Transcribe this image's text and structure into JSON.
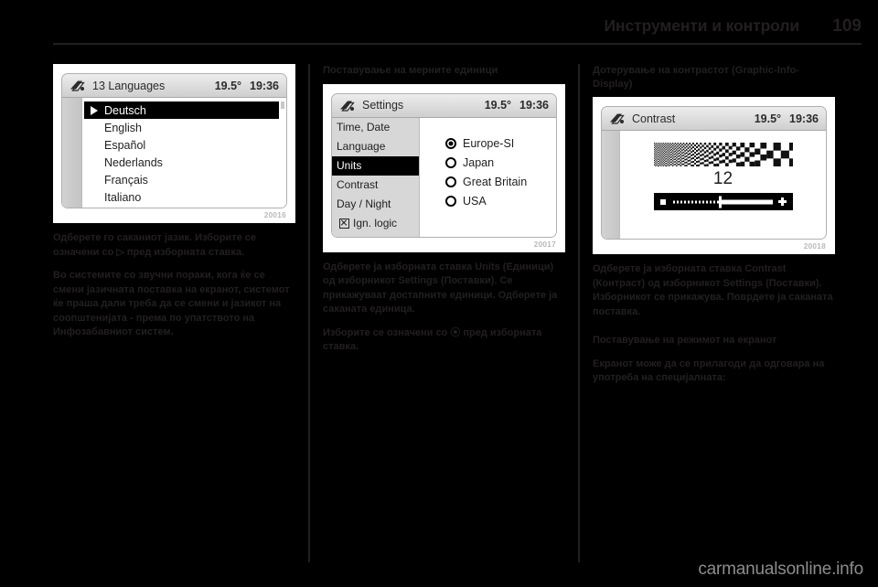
{
  "header": {
    "title": "Инструменти и контроли",
    "page_number": "109"
  },
  "watermark": "carmanualsonline.info",
  "columns": {
    "left": {
      "figure": {
        "number": "20016",
        "screen": {
          "icon": "car-info-icon",
          "title": "13 Languages",
          "temperature": "19.5°",
          "clock": "19:36",
          "items": [
            {
              "label": "Deutsch",
              "selected": true
            },
            {
              "label": "English",
              "selected": false
            },
            {
              "label": "Español",
              "selected": false
            },
            {
              "label": "Nederlands",
              "selected": false
            },
            {
              "label": "Français",
              "selected": false
            },
            {
              "label": "Italiano",
              "selected": false
            }
          ]
        }
      },
      "paragraphs": [
        "Одберете го саканиот јазик. Изборите се означени со ▷ пред изборната ставка.",
        "Во системите со звучни пораки, кога ќе се смени јазичната поставка на екранот, системот ќе праша дали треба да се смени и јазикот на соопштенијата - према по упатството на Инфозабавниот систем."
      ]
    },
    "middle": {
      "heading": "Поставување на мерните единици",
      "figure": {
        "number": "20017",
        "screen": {
          "icon": "car-info-icon",
          "title": "Settings",
          "temperature": "19.5°",
          "clock": "19:36",
          "menu": [
            {
              "label": "Time, Date",
              "selected": false,
              "checkbox": false
            },
            {
              "label": "Language",
              "selected": false,
              "checkbox": false
            },
            {
              "label": "Units",
              "selected": true,
              "checkbox": false
            },
            {
              "label": "Contrast",
              "selected": false,
              "checkbox": false
            },
            {
              "label": "Day / Night",
              "selected": false,
              "checkbox": false
            },
            {
              "label": "Ign. logic",
              "selected": false,
              "checkbox": true
            }
          ],
          "options": [
            {
              "label": "Europe-SI",
              "selected": true
            },
            {
              "label": "Japan",
              "selected": false
            },
            {
              "label": "Great Britain",
              "selected": false
            },
            {
              "label": "USA",
              "selected": false
            }
          ]
        }
      },
      "paragraphs": [
        "Одберете ја изборната ставка Units (Единици) од изборникот Settings (Поставки). Се прикажуваат достапните единици. Одберете ја саканата единица.",
        "Изборите се означени со ⦿ пред изборната ставка."
      ]
    },
    "right": {
      "heading": "Дотерување на контрастот (Graphic-Info-Display)",
      "figure": {
        "number": "20018",
        "screen": {
          "icon": "car-info-icon",
          "title": "Contrast",
          "temperature": "19.5°",
          "clock": "19:36",
          "value": "12",
          "slider": {
            "minus_icon": "minus-icon",
            "plus_icon": "plus-icon",
            "position_percent": 48
          }
        }
      },
      "paragraphs": [
        "Одберете ја изборната ставка Contrast (Контраст) од изборникот Settings (Поставки). Изборникот се прикажува. Поврдете ја саканата поставка."
      ],
      "subheading": "Поставување на режимот на екранот",
      "paragraphs_after": [
        "Екранот може да се прилагоди да одговара на употреба на специјалната:"
      ]
    }
  }
}
